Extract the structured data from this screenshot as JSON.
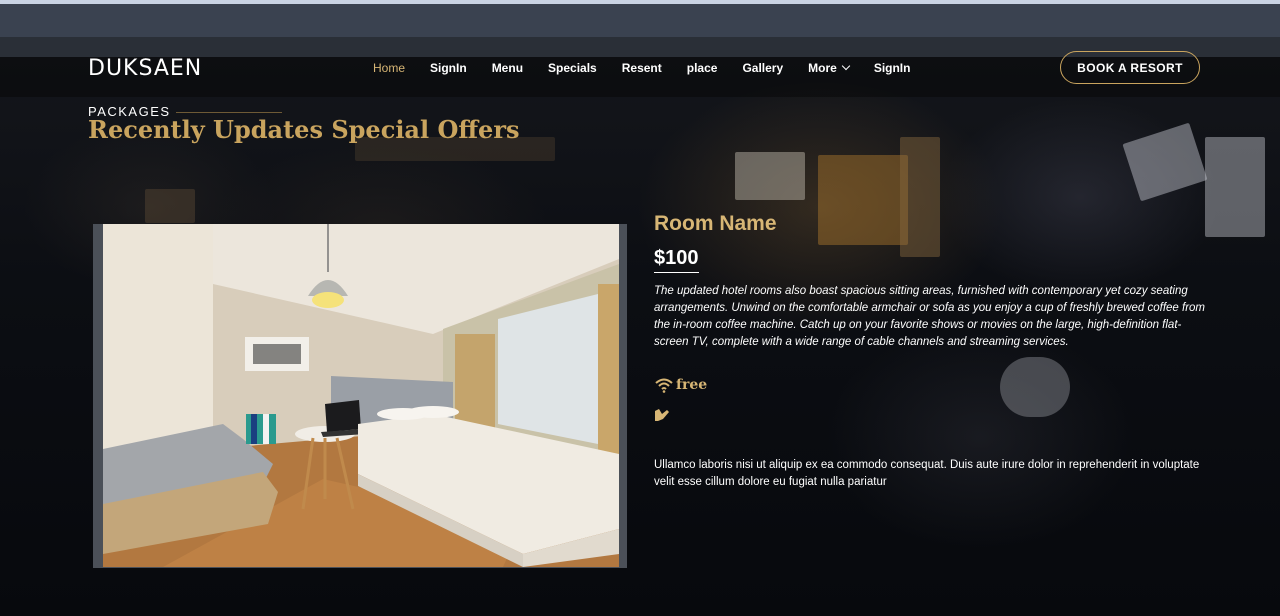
{
  "site": {
    "brand": "DUKSAEN"
  },
  "nav": {
    "items": [
      {
        "label": "Home",
        "active": true
      },
      {
        "label": "SignIn"
      },
      {
        "label": "Menu"
      },
      {
        "label": "Specials"
      },
      {
        "label": "Resent"
      },
      {
        "label": "place"
      },
      {
        "label": "Gallery"
      },
      {
        "label": "More",
        "has_dropdown": true
      },
      {
        "label": "SignIn"
      }
    ],
    "cta_label": "BOOK A RESORT"
  },
  "section": {
    "eyebrow": "PACKAGES",
    "title": "Recently Updates Special Offers"
  },
  "room": {
    "name": "Room Name",
    "price": "$100",
    "description": "The updated hotel rooms also boast spacious sitting areas, furnished with contemporary yet cozy seating arrangements. Unwind on the comfortable armchair or sofa as you enjoy a cup of freshly brewed coffee from the in-room coffee machine. Catch up on your favorite shows or movies on the large, high-definition flat-screen TV, complete with a wide range of cable channels and streaming services.",
    "features": [
      {
        "icon": "wifi-icon",
        "label": "free"
      },
      {
        "icon": "hand-icon",
        "label": ""
      }
    ],
    "note": "Ullamco laboris nisi ut aliquip ex ea commodo consequat. Duis aute irure dolor in reprehenderit in voluptate velit esse cillum dolore eu fugiat nulla pariatur"
  },
  "colors": {
    "accent": "#c9a45e",
    "accent_light": "#d7b675",
    "background": "#05070b"
  }
}
